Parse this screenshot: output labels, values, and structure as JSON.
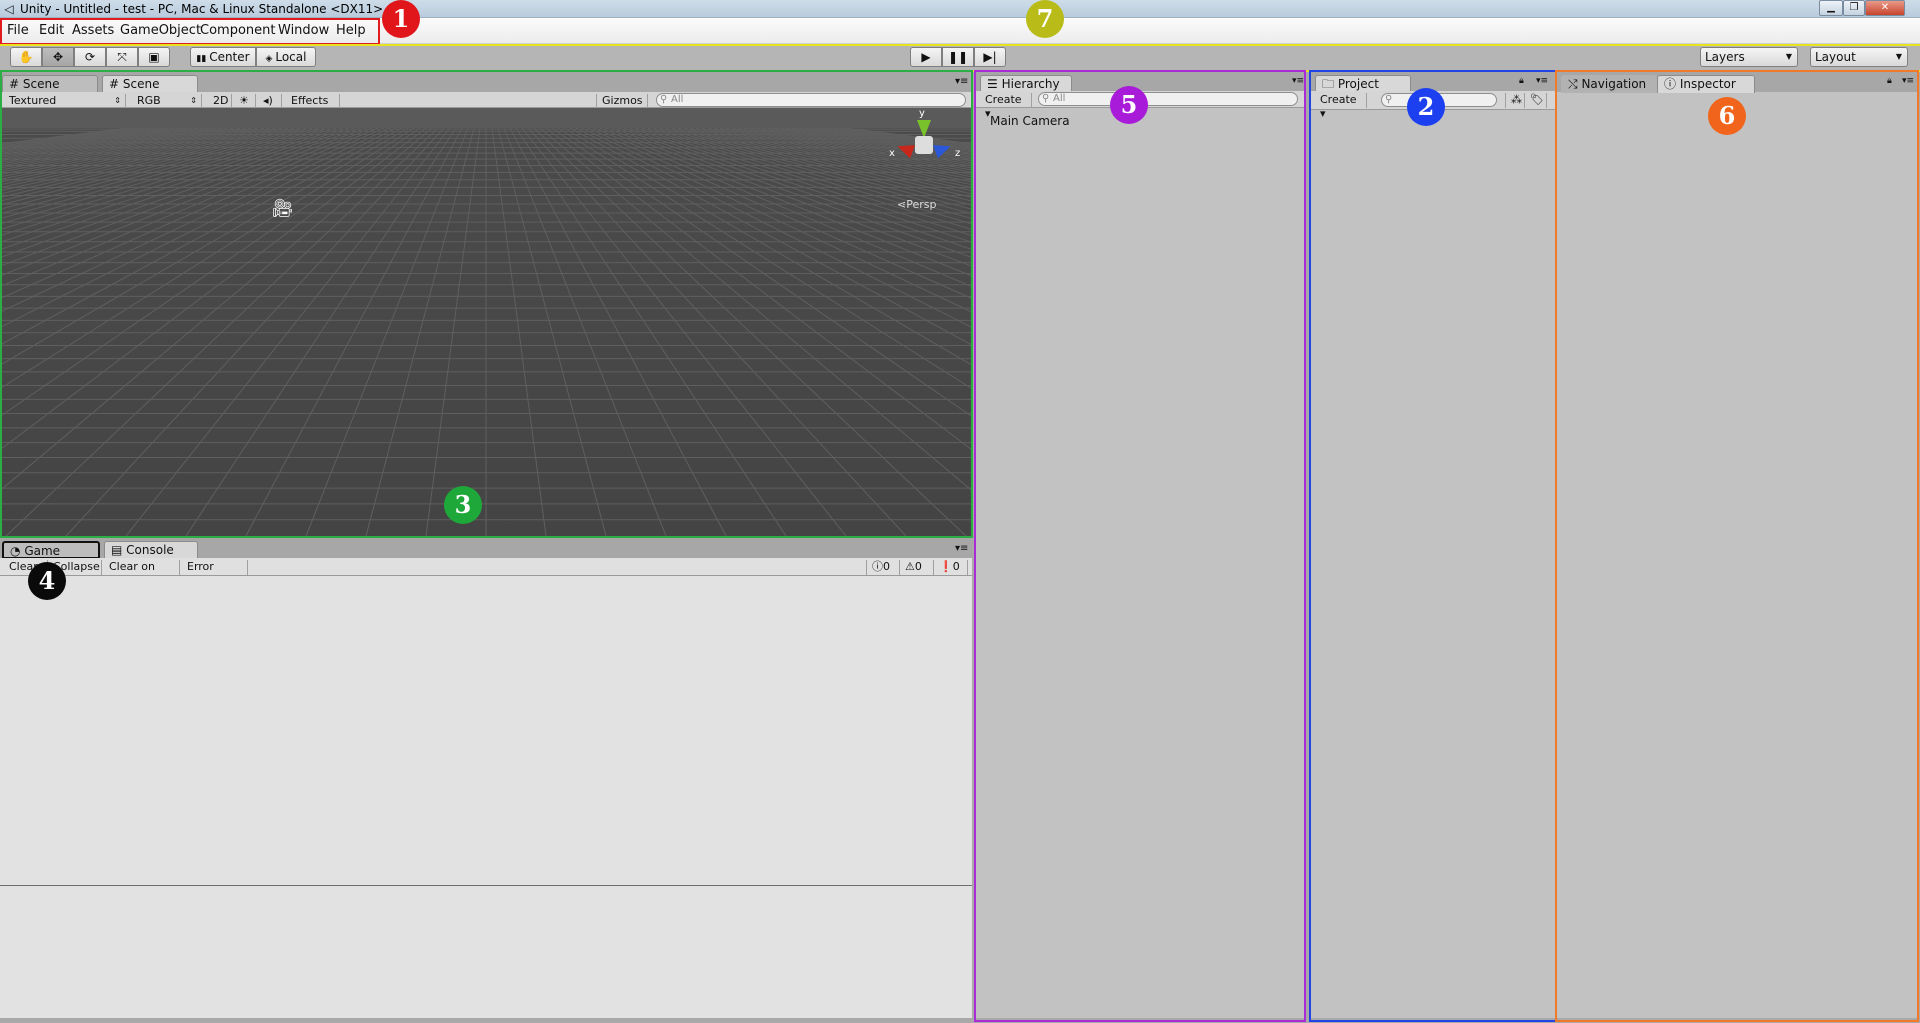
{
  "window": {
    "title": "Unity - Untitled - test - PC, Mac & Linux Standalone <DX11>",
    "app_icon": "unity-icon"
  },
  "menubar": {
    "items": [
      "File",
      "Edit",
      "Assets",
      "GameObject",
      "Component",
      "Window",
      "Help"
    ]
  },
  "toolbar": {
    "tools": [
      "hand-icon",
      "move-icon",
      "rotate-icon",
      "scale-icon",
      "rect-icon"
    ],
    "active_tool": "move-icon",
    "pivot_label": "Center",
    "space_label": "Local",
    "play_icon": "play-icon",
    "pause_icon": "pause-icon",
    "step_icon": "step-icon",
    "layers_label": "Layers",
    "layout_label": "Layout"
  },
  "scene_panel": {
    "tabs": [
      {
        "label": "Scene",
        "icon": "grid-icon"
      },
      {
        "label": "Scene",
        "icon": "grid-icon"
      }
    ],
    "shading_mode": "Textured",
    "render_mode": "RGB",
    "mode_2d": "2D",
    "effects_label": "Effects",
    "gizmos_label": "Gizmos",
    "search_placeholder": "All",
    "gizmo_axes": {
      "y": "y",
      "x": "x",
      "z": "z"
    },
    "projection_label": "Persp"
  },
  "console_panel": {
    "tabs": [
      {
        "label": "Game",
        "icon": "pacman-icon"
      },
      {
        "label": "Console",
        "icon": "console-icon"
      }
    ],
    "clear_label": "Clear",
    "collapse_label": "Collapse",
    "clear_on_play_label": "Clear on Play",
    "error_pause_label": "Error Pause",
    "info_count": "0",
    "warning_count": "0",
    "error_count": "0"
  },
  "hierarchy_panel": {
    "tab_label": "Hierarchy",
    "create_label": "Create",
    "search_placeholder": "All",
    "items": [
      "Main Camera"
    ]
  },
  "project_panel": {
    "tab_label": "Project",
    "create_label": "Create"
  },
  "inspector_panel": {
    "tabs": [
      {
        "label": "Navigation",
        "icon": "navigation-icon"
      },
      {
        "label": "Inspector",
        "icon": "info-icon"
      }
    ]
  },
  "annotations": [
    {
      "label": "1",
      "color": "#e0161a"
    },
    {
      "label": "2",
      "color": "#1c3ff0"
    },
    {
      "label": "3",
      "color": "#1fa83a"
    },
    {
      "label": "4",
      "color": "#0a0a0a"
    },
    {
      "label": "5",
      "color": "#a81bd8"
    },
    {
      "label": "6",
      "color": "#f0651b"
    },
    {
      "label": "7",
      "color": "#b8bb18"
    }
  ],
  "colors": {
    "outline_menu": "#e21b1f",
    "outline_toolbar": "#e6e320",
    "outline_scene": "#2cae45",
    "outline_hierarchy": "#a92cd6",
    "outline_project": "#2243e8",
    "outline_inspector": "#f07a2a"
  }
}
